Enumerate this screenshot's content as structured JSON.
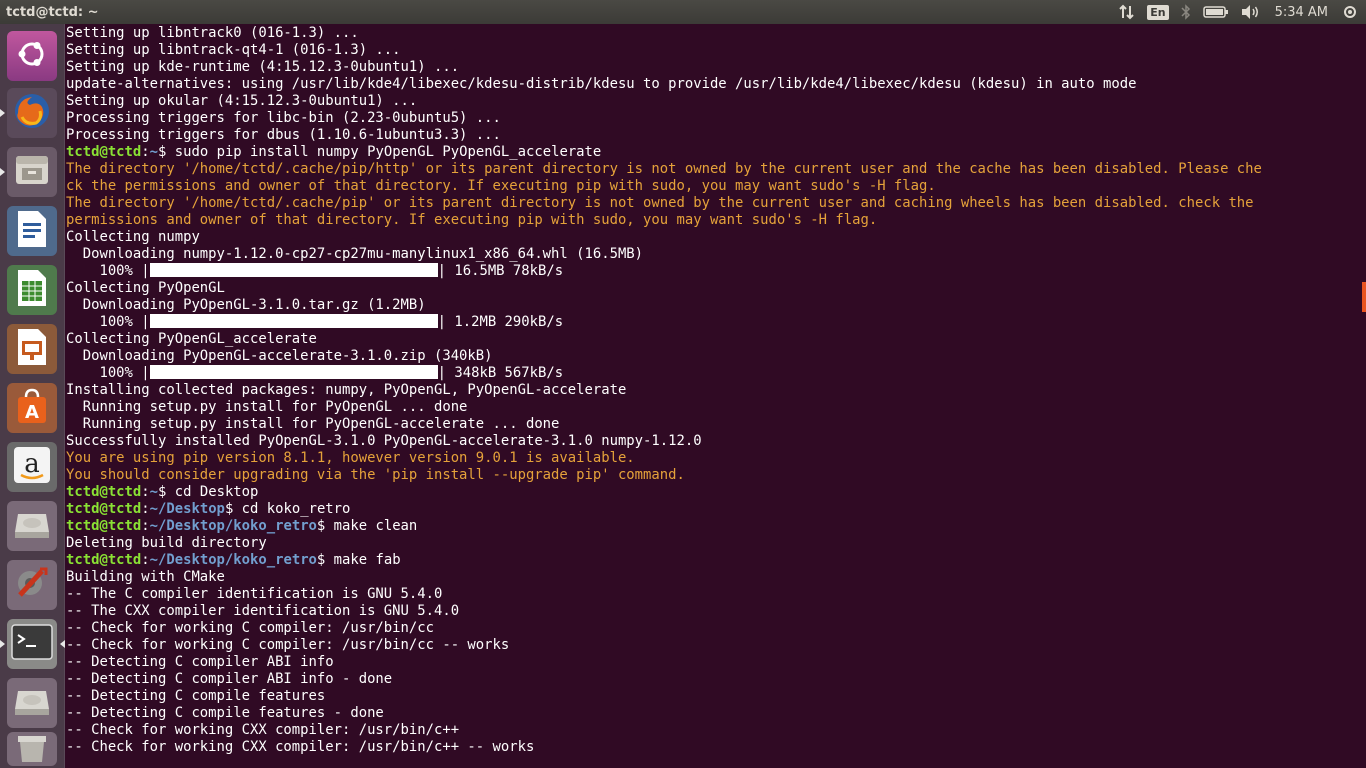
{
  "topbar": {
    "title": "tctd@tctd: ~",
    "keyboard_layout": "En",
    "clock": "5:34 AM",
    "icons": [
      "network-transfer-icon",
      "keyboard-layout-indicator",
      "bluetooth-icon",
      "battery-icon",
      "volume-icon"
    ]
  },
  "launcher": {
    "items": [
      {
        "name": "ubuntu-dash-icon",
        "label": "Search your computer"
      },
      {
        "name": "firefox-icon",
        "label": "Firefox Web Browser"
      },
      {
        "name": "files-icon",
        "label": "Files"
      },
      {
        "name": "libreoffice-writer-icon",
        "label": "LibreOffice Writer"
      },
      {
        "name": "libreoffice-calc-icon",
        "label": "LibreOffice Calc"
      },
      {
        "name": "libreoffice-impress-icon",
        "label": "LibreOffice Impress"
      },
      {
        "name": "software-center-icon",
        "label": "Ubuntu Software"
      },
      {
        "name": "amazon-icon",
        "label": "Amazon"
      },
      {
        "name": "drive-icon",
        "label": "Drive"
      },
      {
        "name": "system-settings-icon",
        "label": "System Settings"
      },
      {
        "name": "terminal-icon",
        "label": "Terminal"
      },
      {
        "name": "drive-icon-2",
        "label": "Drive"
      },
      {
        "name": "trash-icon",
        "label": "Trash"
      }
    ]
  },
  "terminal": {
    "user_host": "tctd@tctd",
    "colors": {
      "background": "#300a24",
      "prompt_user": "#8ae234",
      "prompt_path": "#729fcf",
      "warning": "#e5a23a",
      "text": "#ffffff"
    },
    "lines": [
      {
        "type": "text",
        "text": "Setting up libntrack0 (016-1.3) ..."
      },
      {
        "type": "text",
        "text": "Setting up libntrack-qt4-1 (016-1.3) ..."
      },
      {
        "type": "text",
        "text": "Setting up kde-runtime (4:15.12.3-0ubuntu1) ..."
      },
      {
        "type": "text",
        "text": "update-alternatives: using /usr/lib/kde4/libexec/kdesu-distrib/kdesu to provide /usr/lib/kde4/libexec/kdesu (kdesu) in auto mode"
      },
      {
        "type": "text",
        "text": "Setting up okular (4:15.12.3-0ubuntu1) ..."
      },
      {
        "type": "text",
        "text": "Processing triggers for libc-bin (2.23-0ubuntu5) ..."
      },
      {
        "type": "text",
        "text": "Processing triggers for dbus (1.10.6-1ubuntu3.3) ..."
      },
      {
        "type": "prompt",
        "user": "tctd@tctd",
        "path": "~",
        "cmd": "sudo pip install numpy PyOpenGL PyOpenGL_accelerate"
      },
      {
        "type": "warn",
        "text": "The directory '/home/tctd/.cache/pip/http' or its parent directory is not owned by the current user and the cache has been disabled. Please che"
      },
      {
        "type": "warn",
        "text": "ck the permissions and owner of that directory. If executing pip with sudo, you may want sudo's -H flag."
      },
      {
        "type": "warn",
        "text": "The directory '/home/tctd/.cache/pip' or its parent directory is not owned by the current user and caching wheels has been disabled. check the"
      },
      {
        "type": "warn",
        "text": "permissions and owner of that directory. If executing pip with sudo, you may want sudo's -H flag."
      },
      {
        "type": "text",
        "text": "Collecting numpy"
      },
      {
        "type": "text",
        "text": "  Downloading numpy-1.12.0-cp27-cp27mu-manylinux1_x86_64.whl (16.5MB)"
      },
      {
        "type": "progress",
        "pct": "    100% |",
        "fill": 1.0,
        "tail": "| 16.5MB 78kB/s"
      },
      {
        "type": "text",
        "text": "Collecting PyOpenGL"
      },
      {
        "type": "text",
        "text": "  Downloading PyOpenGL-3.1.0.tar.gz (1.2MB)"
      },
      {
        "type": "progress",
        "pct": "    100% |",
        "fill": 1.0,
        "tail": "| 1.2MB 290kB/s"
      },
      {
        "type": "text",
        "text": "Collecting PyOpenGL_accelerate"
      },
      {
        "type": "text",
        "text": "  Downloading PyOpenGL-accelerate-3.1.0.zip (340kB)"
      },
      {
        "type": "progress",
        "pct": "    100% |",
        "fill": 1.0,
        "tail": "| 348kB 567kB/s"
      },
      {
        "type": "text",
        "text": "Installing collected packages: numpy, PyOpenGL, PyOpenGL-accelerate"
      },
      {
        "type": "text",
        "text": "  Running setup.py install for PyOpenGL ... done"
      },
      {
        "type": "text",
        "text": "  Running setup.py install for PyOpenGL-accelerate ... done"
      },
      {
        "type": "text",
        "text": "Successfully installed PyOpenGL-3.1.0 PyOpenGL-accelerate-3.1.0 numpy-1.12.0"
      },
      {
        "type": "warn",
        "text": "You are using pip version 8.1.1, however version 9.0.1 is available."
      },
      {
        "type": "warn",
        "text": "You should consider upgrading via the 'pip install --upgrade pip' command."
      },
      {
        "type": "prompt",
        "user": "tctd@tctd",
        "path": "~",
        "cmd": "cd Desktop"
      },
      {
        "type": "prompt",
        "user": "tctd@tctd",
        "path": "~/Desktop",
        "cmd": "cd koko_retro"
      },
      {
        "type": "prompt",
        "user": "tctd@tctd",
        "path": "~/Desktop/koko_retro",
        "cmd": "make clean"
      },
      {
        "type": "text",
        "text": "Deleting build directory"
      },
      {
        "type": "prompt",
        "user": "tctd@tctd",
        "path": "~/Desktop/koko_retro",
        "cmd": "make fab"
      },
      {
        "type": "text",
        "text": "Building with CMake"
      },
      {
        "type": "text",
        "text": "-- The C compiler identification is GNU 5.4.0"
      },
      {
        "type": "text",
        "text": "-- The CXX compiler identification is GNU 5.4.0"
      },
      {
        "type": "text",
        "text": "-- Check for working C compiler: /usr/bin/cc"
      },
      {
        "type": "text",
        "text": "-- Check for working C compiler: /usr/bin/cc -- works"
      },
      {
        "type": "text",
        "text": "-- Detecting C compiler ABI info"
      },
      {
        "type": "text",
        "text": "-- Detecting C compiler ABI info - done"
      },
      {
        "type": "text",
        "text": "-- Detecting C compile features"
      },
      {
        "type": "text",
        "text": "-- Detecting C compile features - done"
      },
      {
        "type": "text",
        "text": "-- Check for working CXX compiler: /usr/bin/c++"
      },
      {
        "type": "text",
        "text": "-- Check for working CXX compiler: /usr/bin/c++ -- works"
      }
    ]
  }
}
